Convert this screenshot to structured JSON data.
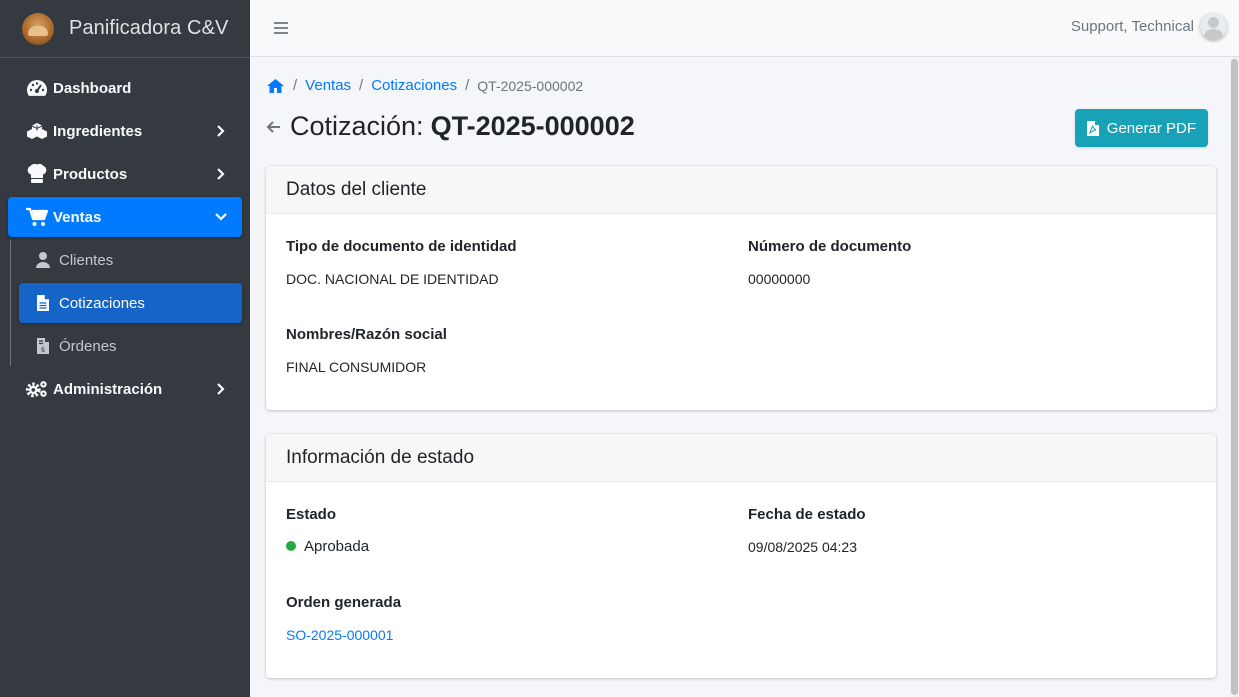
{
  "brand": {
    "name": "Panificadora C&V"
  },
  "sidebar": {
    "items": [
      {
        "label": "Dashboard",
        "icon": "dashboard-icon"
      },
      {
        "label": "Ingredientes",
        "icon": "cubes-icon"
      },
      {
        "label": "Productos",
        "icon": "chef-hat-icon"
      },
      {
        "label": "Ventas",
        "icon": "cart-icon"
      },
      {
        "label": "Administración",
        "icon": "cogs-icon"
      }
    ],
    "subitems": [
      {
        "label": "Clientes",
        "icon": "user-icon"
      },
      {
        "label": "Cotizaciones",
        "icon": "file-icon"
      },
      {
        "label": "Órdenes",
        "icon": "invoice-icon"
      }
    ]
  },
  "topbar": {
    "user": "Support, Technical"
  },
  "breadcrumb": {
    "level1": "Ventas",
    "level2": "Cotizaciones",
    "current": "QT-2025-000002"
  },
  "page": {
    "title_prefix": "Cotización:",
    "title_code": "QT-2025-000002",
    "pdf_button": "Generar PDF"
  },
  "client_card": {
    "title": "Datos del cliente",
    "doc_type_label": "Tipo de documento de identidad",
    "doc_type_value": "DOC. NACIONAL DE IDENTIDAD",
    "doc_number_label": "Número de documento",
    "doc_number_value": "00000000",
    "name_label": "Nombres/Razón social",
    "name_value": "FINAL CONSUMIDOR"
  },
  "status_card": {
    "title": "Información de estado",
    "status_label": "Estado",
    "status_value": "Aprobada",
    "status_color": "#28a745",
    "date_label": "Fecha de estado",
    "date_value": "09/08/2025 04:23",
    "order_label": "Orden generada",
    "order_value": "SO-2025-000001"
  },
  "colors": {
    "primary": "#007bff",
    "info": "#17a2b8",
    "sidebar": "#343a40"
  }
}
